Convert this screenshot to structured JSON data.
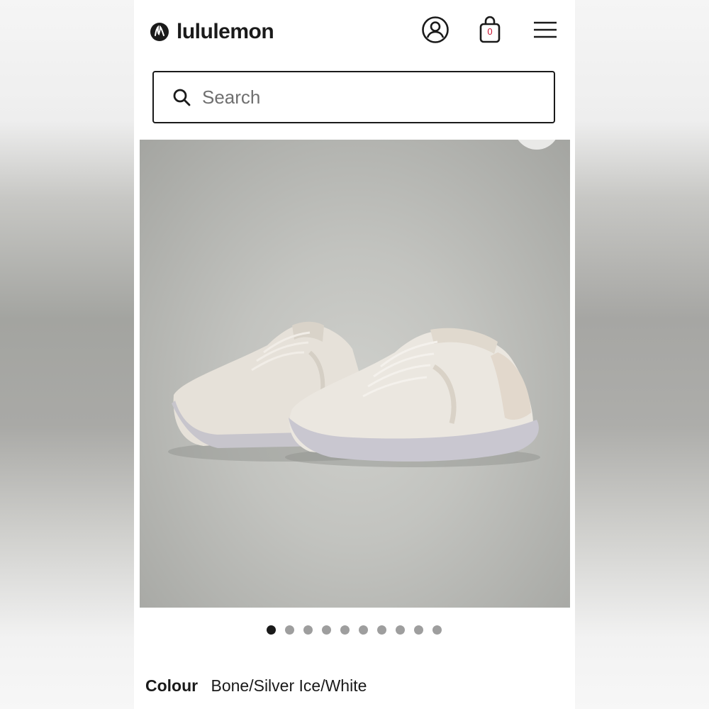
{
  "header": {
    "brand": "lululemon",
    "bag_count": "0"
  },
  "search": {
    "placeholder": "Search"
  },
  "product": {
    "image_alt": "Bone/Silver Ice/White running shoes",
    "carousel": {
      "total": 10,
      "active_index": 0
    },
    "colour_label": "Colour",
    "colour_value": "Bone/Silver Ice/White"
  },
  "icons": [
    "lululemon-logo-icon",
    "account-icon",
    "shopping-bag-icon",
    "hamburger-menu-icon",
    "search-icon"
  ]
}
